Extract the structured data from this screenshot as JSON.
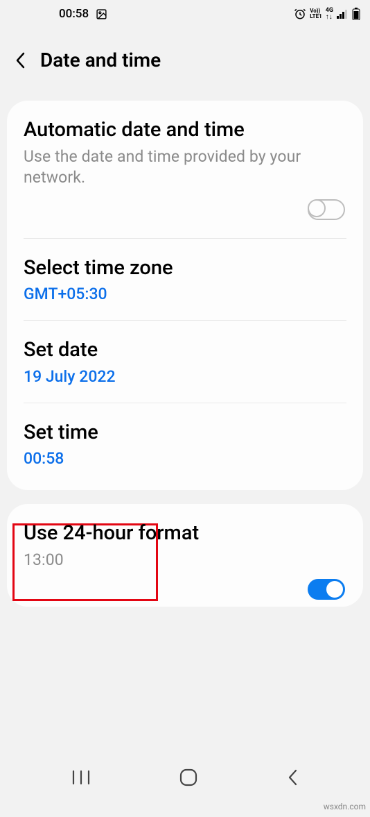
{
  "status": {
    "time": "00:58"
  },
  "header": {
    "title": "Date and time"
  },
  "auto": {
    "title": "Automatic date and time",
    "subtitle": "Use the date and time provided by your network."
  },
  "timezone": {
    "title": "Select time zone",
    "value": "GMT+05:30"
  },
  "date": {
    "title": "Set date",
    "value": "19 July 2022"
  },
  "time": {
    "title": "Set time",
    "value": "00:58"
  },
  "hour24": {
    "title": "Use 24-hour format",
    "subtitle": "13:00"
  },
  "watermark": "wsxdn.com"
}
